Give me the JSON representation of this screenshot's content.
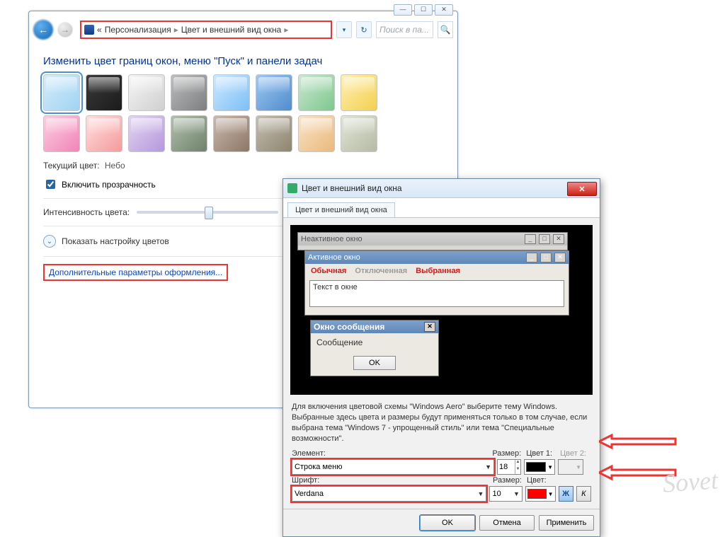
{
  "titlebar": {
    "minimize": "—",
    "maximize": "☐",
    "close": "✕"
  },
  "breadcrumb": {
    "prefix": "«",
    "item1": "Персонализация",
    "item2": "Цвет и внешний вид окна"
  },
  "search": {
    "placeholder": "Поиск в па..."
  },
  "heading": "Изменить цвет границ окон, меню \"Пуск\" и панели задач",
  "swatches": {
    "row1": [
      {
        "c1": "#d7ecfa",
        "c2": "#9fd3f3"
      },
      {
        "c1": "#3a3a3a",
        "c2": "#1b1b1b"
      },
      {
        "c1": "#f6f6f6",
        "c2": "#cfcfcf"
      },
      {
        "c1": "#bcbdbe",
        "c2": "#7d7e7f"
      },
      {
        "c1": "#cfe8ff",
        "c2": "#7cbff5"
      },
      {
        "c1": "#9fc8f1",
        "c2": "#4f8cce"
      },
      {
        "c1": "#cbe7d2",
        "c2": "#7ec88d"
      },
      {
        "c1": "#fff0b6",
        "c2": "#f3d04e"
      }
    ],
    "row2": [
      {
        "c1": "#fbcfe1",
        "c2": "#f184b7"
      },
      {
        "c1": "#ffdfdf",
        "c2": "#f59a9a"
      },
      {
        "c1": "#e2d5f1",
        "c2": "#b598dc"
      },
      {
        "c1": "#b1bfae",
        "c2": "#6e826a"
      },
      {
        "c1": "#c9b9ae",
        "c2": "#8e7666"
      },
      {
        "c1": "#c4beb2",
        "c2": "#8d856f"
      },
      {
        "c1": "#f9e3cb",
        "c2": "#eab97a"
      },
      {
        "c1": "#e1e5d8",
        "c2": "#b5bba4"
      }
    ]
  },
  "current_label": "Текущий цвет:",
  "current_value": "Небо",
  "transparency_label": "Включить прозрачность",
  "intensity_label": "Интенсивность цвета:",
  "expand_label": "Показать настройку цветов",
  "adv_link": "Дополнительные параметры оформления...",
  "dialog": {
    "title": "Цвет и внешний вид окна",
    "tab": "Цвет и внешний вид окна",
    "inactive": "Неактивное окно",
    "active": "Активное окно",
    "tab1": "Обычная",
    "tab2": "Отключенная",
    "tab3": "Выбранная",
    "text_in_window": "Текст в окне",
    "msg_title": "Окно сообщения",
    "msg_body": "Сообщение",
    "msg_ok": "OK",
    "help": "Для включения цветовой схемы \"Windows Aero\" выберите тему Windows. Выбранные здесь цвета и размеры будут применяться только в том случае, если выбрана тема \"Windows 7 - упрощенный стиль\" или тема \"Специальные возможности\".",
    "element_label": "Элемент:",
    "element_value": "Строка меню",
    "size_label": "Размер:",
    "size1_value": "18",
    "size2_value": "10",
    "color1_label": "Цвет 1:",
    "color2_label": "Цвет 2:",
    "color1_value": "#000000",
    "font_label": "Шрифт:",
    "font_value": "Verdana",
    "color_label": "Цвет:",
    "font_color_value": "#ff0000",
    "bold_label": "Ж",
    "italic_label": "К",
    "ok": "OK",
    "cancel": "Отмена",
    "apply": "Применить"
  },
  "watermark": "Sovet"
}
